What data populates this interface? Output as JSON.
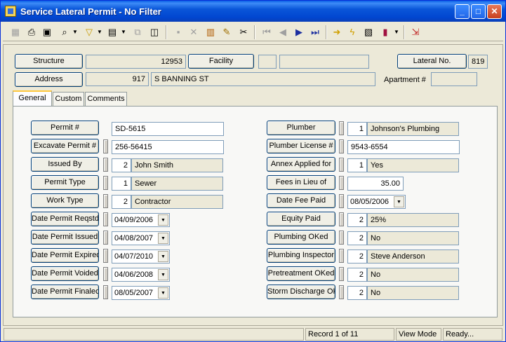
{
  "window": {
    "title": "Service Lateral Permit - No Filter"
  },
  "header": {
    "structure_label": "Structure",
    "structure_value": "12953",
    "facility_label": "Facility",
    "facility_code": "",
    "facility_name": "",
    "lateral_label": "Lateral No.",
    "lateral_value": "819",
    "address_label": "Address",
    "address_number": "917",
    "address_street": "S BANNING ST",
    "apartment_label": "Apartment #",
    "apartment_value": ""
  },
  "tabs": [
    "General",
    "Custom",
    "Comments"
  ],
  "left_fields": {
    "permit_no": {
      "label": "Permit #",
      "value": "SD-5615"
    },
    "excavate_permit": {
      "label": "Excavate Permit #",
      "value": "256-56415"
    },
    "issued_by": {
      "label": "Issued By",
      "code": "2",
      "value": "John Smith"
    },
    "permit_type": {
      "label": "Permit Type",
      "code": "1",
      "value": "Sewer"
    },
    "work_type": {
      "label": "Work Type",
      "code": "2",
      "value": "Contractor"
    },
    "date_reqstd": {
      "label": "Date Permit Reqstd",
      "value": "04/09/2006"
    },
    "date_issued": {
      "label": "Date Permit Issued",
      "value": "04/08/2007"
    },
    "date_expired": {
      "label": "Date Permit Expired",
      "value": "04/07/2010"
    },
    "date_voided": {
      "label": "Date Permit Voided",
      "value": "04/06/2008"
    },
    "date_finaled": {
      "label": "Date Permit Finaled",
      "value": "08/05/2007"
    }
  },
  "right_fields": {
    "plumber": {
      "label": "Plumber",
      "code": "1",
      "value": "Johnson's Plumbing"
    },
    "plumber_license": {
      "label": "Plumber License #",
      "value": "9543-6554"
    },
    "annex": {
      "label": "Annex Applied for",
      "code": "1",
      "value": "Yes"
    },
    "fees": {
      "label": "Fees in Lieu of",
      "value": "35.00"
    },
    "date_fee_paid": {
      "label": "Date Fee Paid",
      "value": "08/05/2006"
    },
    "equity_paid": {
      "label": "Equity Paid",
      "code": "2",
      "value": "25%"
    },
    "plumbing_oked": {
      "label": "Plumbing OKed",
      "code": "2",
      "value": "No"
    },
    "plumbing_inspector": {
      "label": "Plumbing Inspector",
      "code": "2",
      "value": "Steve Anderson"
    },
    "pretreatment_oked": {
      "label": "Pretreatment OKed",
      "code": "2",
      "value": "No"
    },
    "storm_discharge": {
      "label": "Storm Discharge OK",
      "code": "2",
      "value": "No"
    }
  },
  "status": {
    "record": "Record 1 of 11",
    "mode": "View Mode",
    "state": "Ready..."
  },
  "icons": [
    "app-icon",
    "grid-icon",
    "print-icon",
    "print-preview-icon",
    "binoculars-icon",
    "filter-icon",
    "new-record-icon",
    "copy-record-icon",
    "clone-icon",
    "save-icon",
    "delete-icon",
    "books-icon",
    "pencil-icon",
    "scissors-icon",
    "first-record-icon",
    "previous-record-icon",
    "next-record-icon",
    "last-record-icon",
    "arrow-right-icon",
    "lightning-icon",
    "gallery-icon",
    "book-icon",
    "exit-icon"
  ],
  "colors": {
    "title_bar": "#0a56d8",
    "close_button": "#c8401e",
    "accent_tab": "#ffc83c"
  }
}
